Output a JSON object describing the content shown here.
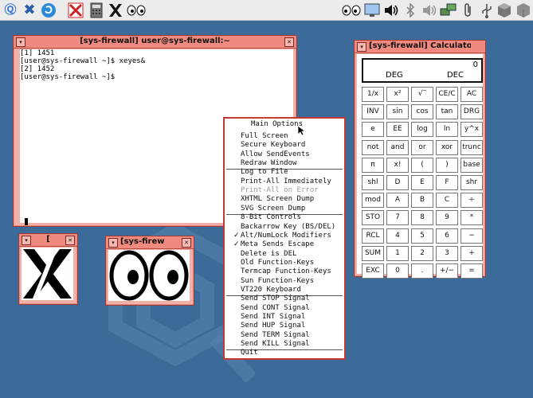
{
  "panel": {
    "icons_left": [
      "q-icon",
      "x-tools-icon",
      "refresh-icon",
      "xterm-x-icon",
      "calculator-icon",
      "xlogo-icon",
      "xeyes-icon"
    ],
    "icons_right": [
      "xeyes-tray-icon",
      "display-icon",
      "volume-icon",
      "bluetooth-icon",
      "speaker-icon",
      "network-icon",
      "paperclip-icon",
      "usb-icon",
      "cube-icon"
    ]
  },
  "terminal": {
    "title": "[sys-firewall] user@sys-firewall:~",
    "lines": [
      "[1] 1451",
      "[user@sys-firewall ~]$ xeyes&",
      "[2] 1452",
      "[user@sys-firewall ~]$ "
    ]
  },
  "xlogo_window": {
    "title": "["
  },
  "xeyes_window": {
    "title": "[sys-firew"
  },
  "menu": {
    "title": "Main Options",
    "groups": [
      [
        {
          "label": "Full Screen"
        },
        {
          "label": "Secure Keyboard"
        },
        {
          "label": "Allow SendEvents"
        },
        {
          "label": "Redraw Window"
        }
      ],
      [
        {
          "label": "Log to File"
        },
        {
          "label": "Print-All Immediately"
        },
        {
          "label": "Print-All on Error",
          "disabled": true
        },
        {
          "label": "XHTML Screen Dump"
        },
        {
          "label": "SVG Screen Dump"
        }
      ],
      [
        {
          "label": "8-Bit Controls"
        },
        {
          "label": "Backarrow Key (BS/DEL)"
        },
        {
          "label": "Alt/NumLock Modifiers",
          "checked": true
        },
        {
          "label": "Meta Sends Escape",
          "checked": true
        },
        {
          "label": "Delete is DEL"
        },
        {
          "label": "Old Function-Keys"
        },
        {
          "label": "Termcap Function-Keys"
        },
        {
          "label": "Sun Function-Keys"
        },
        {
          "label": "VT220 Keyboard"
        }
      ],
      [
        {
          "label": "Send STOP Signal"
        },
        {
          "label": "Send CONT Signal"
        },
        {
          "label": "Send INT Signal"
        },
        {
          "label": "Send HUP Signal"
        },
        {
          "label": "Send TERM Signal"
        },
        {
          "label": "Send KILL Signal"
        }
      ],
      [
        {
          "label": "Quit"
        }
      ]
    ]
  },
  "calculator": {
    "title": "[sys-firewall] Calculato",
    "display_value": "0",
    "angle_mode": "DEG",
    "base_mode": "DEC",
    "keys": [
      [
        "1/x",
        "x²",
        "√‾",
        "CE/C",
        "AC"
      ],
      [
        "INV",
        "sin",
        "cos",
        "tan",
        "DRG"
      ],
      [
        "e",
        "EE",
        "log",
        "ln",
        "y^x"
      ],
      [
        "not",
        "and",
        "or",
        "xor",
        "trunc"
      ],
      [
        "π",
        "x!",
        "(",
        ")",
        "base"
      ],
      [
        "shl",
        "D",
        "E",
        "F",
        "shr"
      ],
      [
        "mod",
        "A",
        "B",
        "C",
        "÷"
      ],
      [
        "STO",
        "7",
        "8",
        "9",
        "*"
      ],
      [
        "RCL",
        "4",
        "5",
        "6",
        "−"
      ],
      [
        "SUM",
        "1",
        "2",
        "3",
        "+"
      ],
      [
        "EXC",
        "0",
        ".",
        "+/−",
        "="
      ]
    ]
  }
}
